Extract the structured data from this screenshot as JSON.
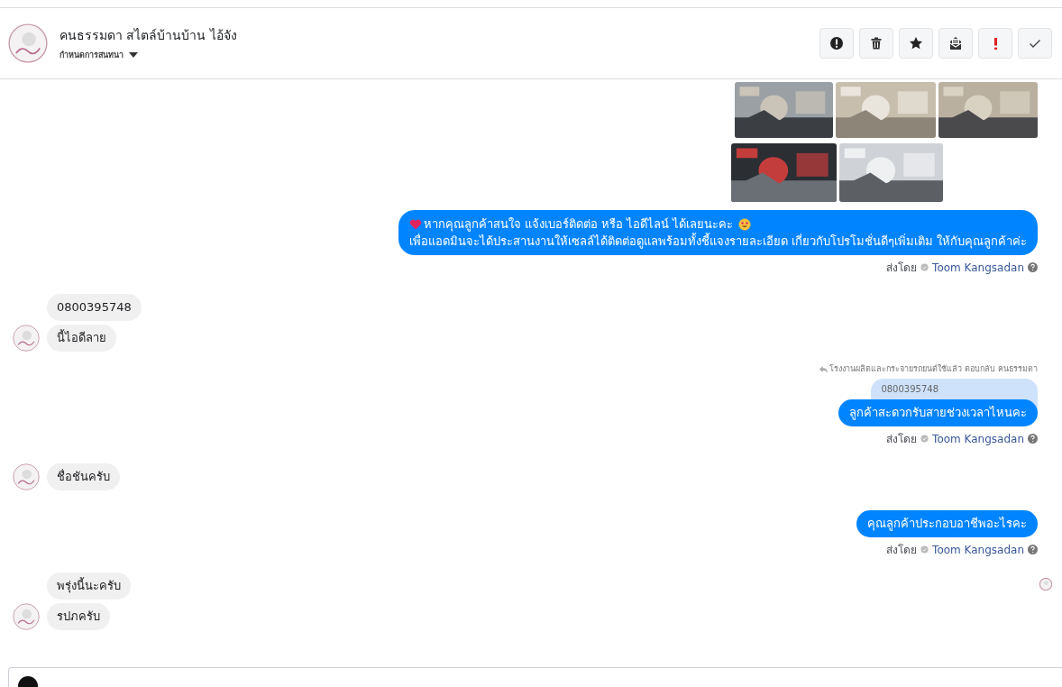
{
  "header": {
    "title": "คนธรรมดา สไตล์บ้านบ้าน ไอ้จัง",
    "subtitle": "กำหนดการสนทนา",
    "actions": [
      {
        "kind": "alert"
      },
      {
        "kind": "trash"
      },
      {
        "kind": "star"
      },
      {
        "kind": "mail"
      },
      {
        "kind": "important"
      },
      {
        "kind": "done"
      }
    ]
  },
  "messages": [
    {
      "kind": "photos"
    },
    {
      "kind": "outgoing",
      "decorated": true,
      "lines": [
        "หากคุณลูกค้าสนใจ แจ้งเบอร์ติดต่อ หรือ ไอดีไลน์ ได้เลยนะคะ",
        "เพื่อแอดมินจะได้ประสานงานให้เซลล์ได้ติดต่อดูแลพร้อมทั้งชี้แจงรายละเอียด เกี่ยวกับโปรโมชั่นดีๆเพิ่มเติม ให้กับคุณลูกค้าค่ะ"
      ],
      "sent_label": "ส่งโดย",
      "sender": "Toom Kangsadan"
    },
    {
      "kind": "incoming",
      "bubbles": [
        "0800395748",
        "นี้ไอดีลาย"
      ]
    },
    {
      "kind": "outgoing",
      "decorated": false,
      "reply_note": "โรงงานผลิตและกระจายรถยนต์ใช้แล้ว ตอบกลับ คนธรรมดา",
      "quote": "0800395748",
      "lines": [
        "ลูกค้าสะดวกรับสายช่วงเวลาไหนคะ"
      ],
      "sent_label": "ส่งโดย",
      "sender": "Toom Kangsadan"
    },
    {
      "kind": "incoming",
      "bubbles": [
        "ชื่อชันครับ"
      ]
    },
    {
      "kind": "outgoing",
      "decorated": false,
      "lines": [
        "คุณลูกค้าประกอบอาชีพอะไรคะ"
      ],
      "sent_label": "ส่งโดย",
      "sender": "Toom Kangsadan"
    },
    {
      "kind": "incoming",
      "seen": true,
      "bubbles": [
        "พรุ่งนี้นะครับ",
        "รปภครับ"
      ]
    }
  ]
}
